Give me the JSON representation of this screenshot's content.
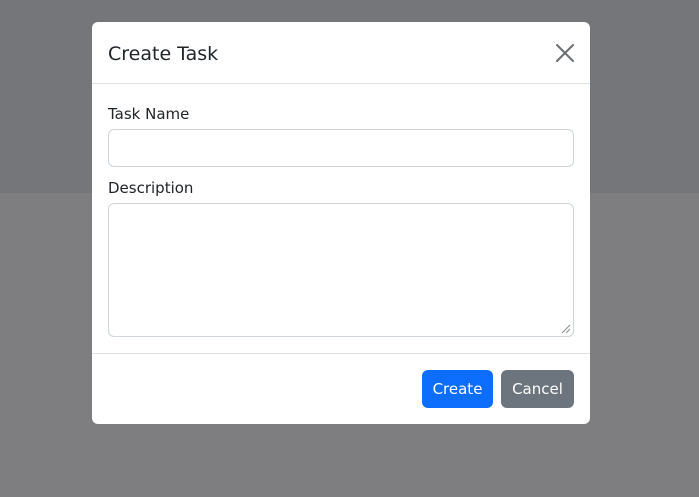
{
  "modal": {
    "title": "Create Task",
    "close_icon": "close-icon",
    "fields": {
      "task_name": {
        "label": "Task Name",
        "value": "",
        "placeholder": ""
      },
      "description": {
        "label": "Description",
        "value": "",
        "placeholder": ""
      }
    },
    "footer": {
      "create_label": "Create",
      "cancel_label": "Cancel"
    }
  },
  "colors": {
    "backdrop_top": "#747679",
    "backdrop_bottom": "#7e7e80",
    "primary": "#0d6efd",
    "secondary": "#6c757d",
    "text": "#212529",
    "border": "#dee2e6"
  }
}
